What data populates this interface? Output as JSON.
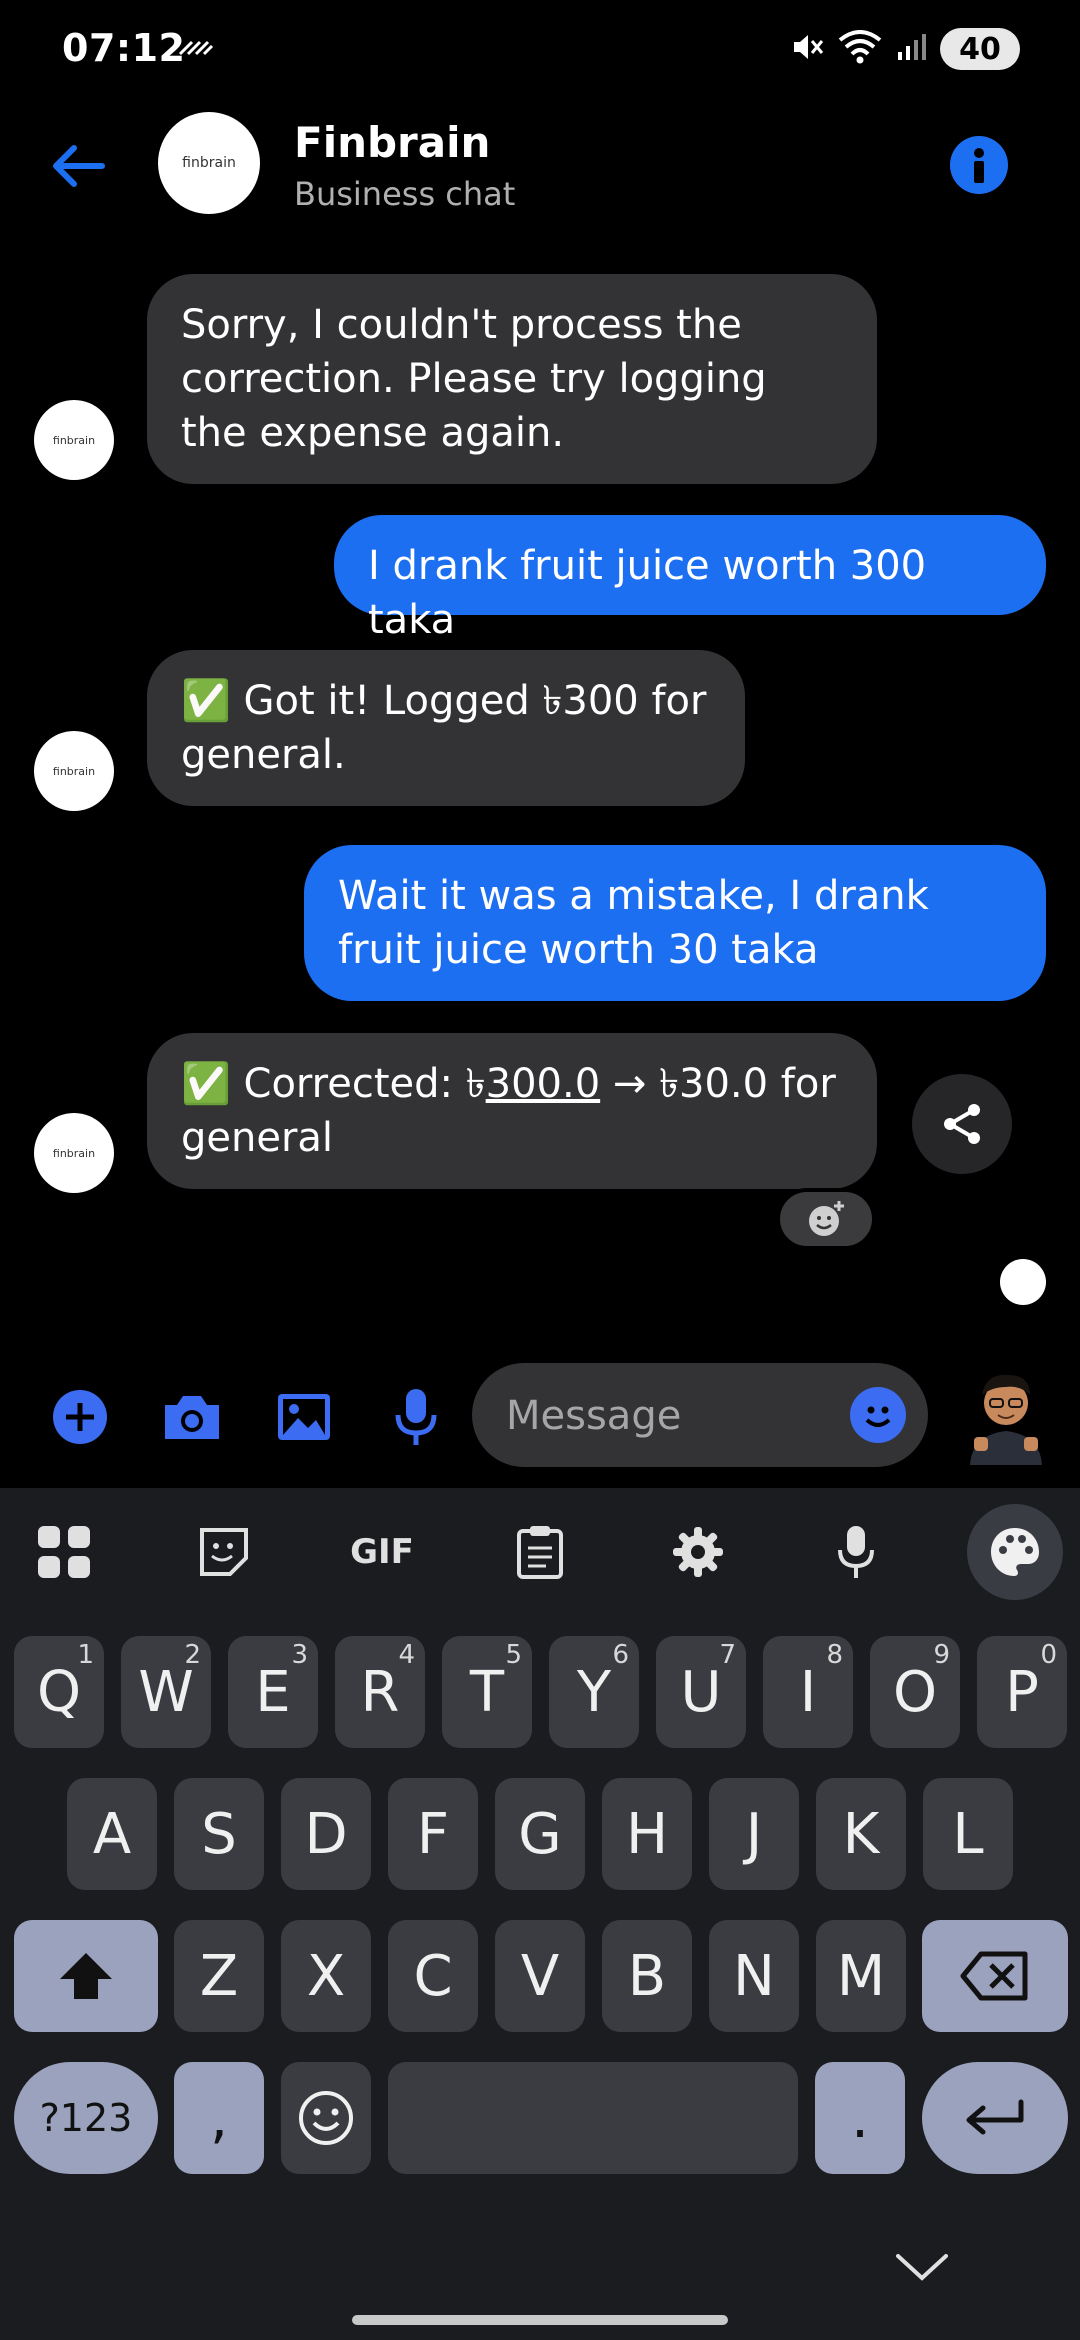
{
  "status_bar": {
    "time": "07:12",
    "battery": "40"
  },
  "header": {
    "contact_name": "Finbrain",
    "subtitle": "Business chat",
    "avatar_text": "finbrain"
  },
  "messages": [
    {
      "from": "bot",
      "text": "Sorry, I couldn't process the correction. Please try logging the expense again."
    },
    {
      "from": "user",
      "text": "I drank fruit juice worth 300 taka"
    },
    {
      "from": "bot",
      "text": "✅ Got it! Logged ৳300 for general."
    },
    {
      "from": "user",
      "text": "Wait it was a mistake, I drank fruit juice worth 30 taka"
    },
    {
      "from": "bot",
      "prefix": "✅ Corrected: ৳",
      "underlined": "300.0",
      "suffix": " → ৳30.0 for general"
    }
  ],
  "composer": {
    "placeholder": "Message"
  },
  "keyboard": {
    "toolbar": {
      "gif_label": "GIF"
    },
    "row1": [
      {
        "label": "Q",
        "hint": "1"
      },
      {
        "label": "W",
        "hint": "2"
      },
      {
        "label": "E",
        "hint": "3"
      },
      {
        "label": "R",
        "hint": "4"
      },
      {
        "label": "T",
        "hint": "5"
      },
      {
        "label": "Y",
        "hint": "6"
      },
      {
        "label": "U",
        "hint": "7"
      },
      {
        "label": "I",
        "hint": "8"
      },
      {
        "label": "O",
        "hint": "9"
      },
      {
        "label": "P",
        "hint": "0"
      }
    ],
    "row2": [
      "A",
      "S",
      "D",
      "F",
      "G",
      "H",
      "J",
      "K",
      "L"
    ],
    "row3": [
      "Z",
      "X",
      "C",
      "V",
      "B",
      "N",
      "M"
    ],
    "symbols_label": "?123",
    "comma_label": ",",
    "period_label": "."
  }
}
